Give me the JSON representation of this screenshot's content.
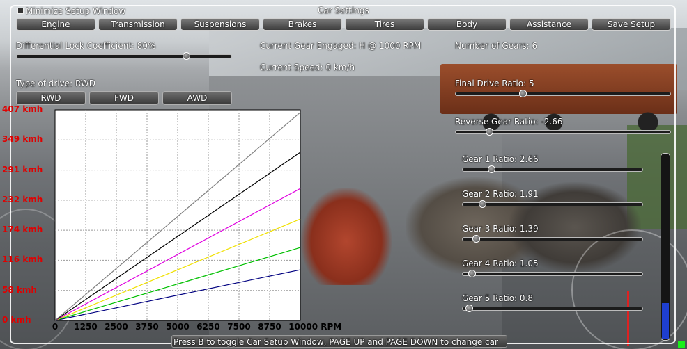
{
  "window": {
    "minimize_label": "Minimize Setup Window",
    "title": "Car Settings",
    "footer_hint": "Press B to toggle Car Setup Window, PAGE UP and PAGE DOWN to change car"
  },
  "tabs": [
    {
      "label": "Engine"
    },
    {
      "label": "Transmission"
    },
    {
      "label": "Suspensions"
    },
    {
      "label": "Brakes"
    },
    {
      "label": "Tires"
    },
    {
      "label": "Body"
    },
    {
      "label": "Assistance"
    },
    {
      "label": "Save Setup"
    }
  ],
  "transmission": {
    "diff_lock": {
      "label": "Differential Lock Coefficient: 80%",
      "value_percent": 80
    },
    "current_gear": "Current Gear Engaged: H @ 1000 RPM",
    "current_speed": "Current Speed: 0 km/h",
    "num_gears": "Number of Gears: 6",
    "drive_type": {
      "label": "Type of drive: RWD",
      "options": [
        "RWD",
        "FWD",
        "AWD"
      ]
    },
    "final_drive": {
      "label": "Final Drive Ratio: 5",
      "value": 5
    },
    "reverse": {
      "label": "Reverse Gear Ratio: -2.66",
      "value": -2.66
    },
    "gears": [
      {
        "label": "Gear 1 Ratio: 2.66",
        "value": 2.66
      },
      {
        "label": "Gear 2 Ratio: 1.91",
        "value": 1.91
      },
      {
        "label": "Gear 3 Ratio: 1.39",
        "value": 1.39
      },
      {
        "label": "Gear 4 Ratio: 1.05",
        "value": 1.05
      },
      {
        "label": "Gear 5 Ratio: 0.8",
        "value": 0.8
      }
    ]
  },
  "colors": {
    "accent_red": "#e00000",
    "gear_lines": [
      "#000080",
      "#00c000",
      "#f0e000",
      "#e000e0",
      "#000000",
      "#808080"
    ]
  },
  "chart_data": {
    "type": "line",
    "xlabel": "RPM",
    "x_ticks": [
      "0",
      "1250",
      "2500",
      "3750",
      "5000",
      "6250",
      "7500",
      "8750",
      "10000 RPM"
    ],
    "y_ticks": [
      "0 kmh",
      "58 kmh",
      "116 kmh",
      "174 kmh",
      "232 kmh",
      "291 kmh",
      "349 kmh",
      "407 kmh"
    ],
    "xlim": [
      0,
      10000
    ],
    "ylim": [
      0,
      407
    ],
    "grid": true,
    "series": [
      {
        "color": "#000080",
        "x": [
          0,
          10000
        ],
        "y": [
          0,
          98
        ]
      },
      {
        "color": "#00c000",
        "x": [
          0,
          10000
        ],
        "y": [
          0,
          141
        ]
      },
      {
        "color": "#f0e000",
        "x": [
          0,
          10000
        ],
        "y": [
          0,
          196
        ]
      },
      {
        "color": "#e000e0",
        "x": [
          0,
          10000
        ],
        "y": [
          0,
          255
        ]
      },
      {
        "color": "#000000",
        "x": [
          0,
          10000
        ],
        "y": [
          0,
          325
        ]
      },
      {
        "color": "#808080",
        "x": [
          0,
          10000
        ],
        "y": [
          0,
          402
        ]
      }
    ]
  }
}
